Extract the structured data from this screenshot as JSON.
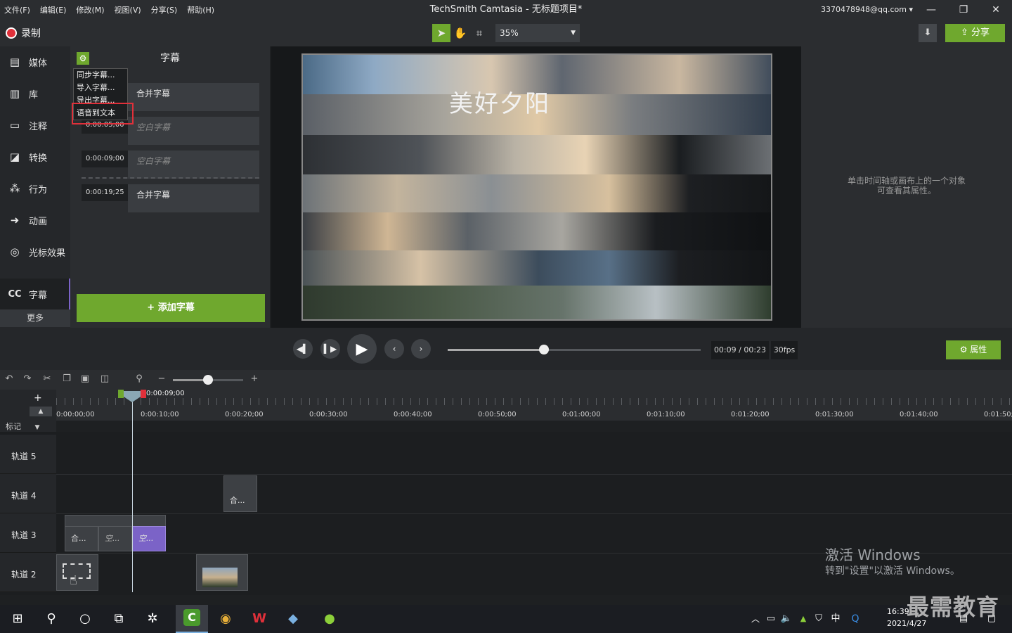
{
  "menu": [
    "文件(F)",
    "编辑(E)",
    "修改(M)",
    "视图(V)",
    "分享(S)",
    "帮助(H)"
  ],
  "title": "TechSmith Camtasia - 无标题项目*",
  "account": "3370478948@qq.com",
  "toolbar": {
    "record": "录制",
    "zoom": "35%",
    "share": "分享"
  },
  "sidebar": {
    "items": [
      "媒体",
      "库",
      "注释",
      "转换",
      "行为",
      "动画",
      "光标效果"
    ],
    "captions": "字幕",
    "more": "更多"
  },
  "captions": {
    "title": "字幕",
    "menu": [
      "同步字幕...",
      "导入字幕...",
      "导出字幕...",
      "语音到文本"
    ],
    "entries": [
      {
        "time": "",
        "text": "合并字幕"
      },
      {
        "time": "0:00:05;00",
        "text": "空白字幕"
      },
      {
        "time": "0:00:09;00",
        "text": "空白字幕"
      },
      {
        "time": "0:00:19;25",
        "text": "合并字幕"
      }
    ],
    "add": "添加字幕"
  },
  "canvas": {
    "video_title": "美好夕阳"
  },
  "properties": {
    "hint_line1": "单击时间轴或画布上的一个对象",
    "hint_line2": "可查看其属性。",
    "button": "属性"
  },
  "transport": {
    "timecode": "00:09 / 00:23",
    "fps": "30fps",
    "progress": 0.38
  },
  "timeline": {
    "playhead": "0:00:09;00",
    "marker": "标记",
    "ruler": [
      "0:00:00;00",
      "0:00:10;00",
      "0:00:20;00",
      "0:00:30;00",
      "0:00:40;00",
      "0:00:50;00",
      "0:01:00;00",
      "0:01:10;00",
      "0:01:20;00",
      "0:01:30;00",
      "0:01:40;00",
      "0:01:50;"
    ],
    "tracks": [
      "轨道 5",
      "轨道 4",
      "轨道 3",
      "轨道 2"
    ],
    "clips": {
      "t4": "合...",
      "t3a": "合...",
      "t3b": "空...",
      "t3c": "空..."
    }
  },
  "watermark": {
    "line1": "激活 Windows",
    "line2": "转到\"设置\"以激活 Windows。"
  },
  "taskbar": {
    "time": "16:39",
    "date": "2021/4/27",
    "ime": "中"
  },
  "brand": "最需教育"
}
